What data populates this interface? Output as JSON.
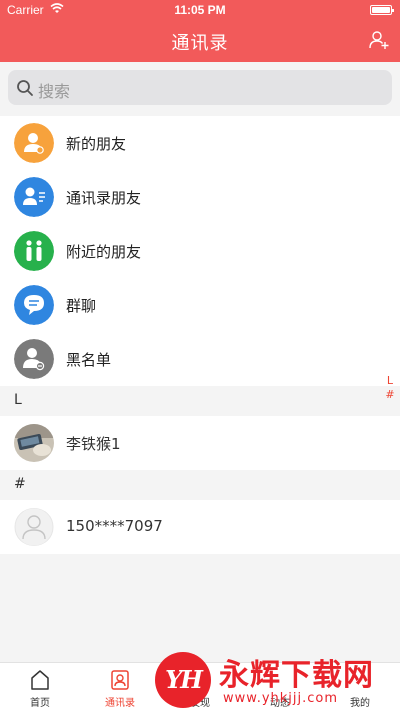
{
  "status_bar": {
    "carrier": "Carrier",
    "time": "11:05 PM"
  },
  "nav": {
    "title": "通讯录",
    "add_icon": "add-user-icon"
  },
  "search": {
    "placeholder": "搜索"
  },
  "menu_items": [
    {
      "label": "新的朋友",
      "icon": "new-friend-icon",
      "color": "#f7a23c"
    },
    {
      "label": "通讯录朋友",
      "icon": "contact-card-icon",
      "color": "#2f86e0"
    },
    {
      "label": "附近的朋友",
      "icon": "nearby-people-icon",
      "color": "#27b14c"
    },
    {
      "label": "群聊",
      "icon": "group-chat-icon",
      "color": "#2f86e0"
    },
    {
      "label": "黑名单",
      "icon": "blacklist-icon",
      "color": "#7a7a7a"
    }
  ],
  "sections": [
    {
      "letter": "L",
      "contacts": [
        {
          "name": "李铁猴1",
          "avatar": "photo"
        }
      ]
    },
    {
      "letter": "#",
      "contacts": [
        {
          "name": "150****7097",
          "avatar": "default"
        }
      ]
    }
  ],
  "index_bar": [
    "L",
    "#"
  ],
  "tabs": [
    {
      "label": "首页",
      "icon": "home-icon",
      "active": false
    },
    {
      "label": "通讯录",
      "icon": "contacts-icon",
      "active": true
    },
    {
      "label": "发现",
      "icon": "discover-icon",
      "active": false
    },
    {
      "label": "动态",
      "icon": "moments-icon",
      "active": false
    },
    {
      "label": "我的",
      "icon": "profile-icon",
      "active": false
    }
  ],
  "watermark": {
    "logo": "YH",
    "title": "永辉下载网",
    "url": "www.yhkjjj.com"
  },
  "colors": {
    "accent": "#f25a5a",
    "active_tab": "#e43333"
  }
}
